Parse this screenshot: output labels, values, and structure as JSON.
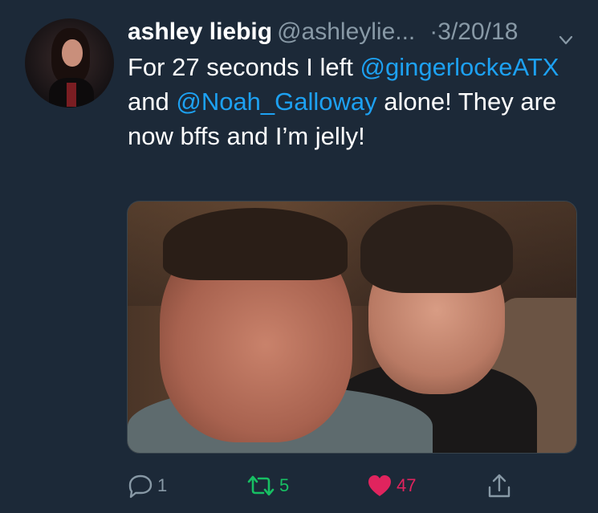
{
  "tweet": {
    "display_name": "ashley liebig",
    "handle": "@ashleylie...",
    "date": "3/20/18",
    "text": {
      "part1": "For 27 seconds I left ",
      "mention1": "@gingerlockeATX",
      "part2": " and ",
      "mention2": "@Noah_Galloway",
      "part3": " alone! They are now bffs and I’m jelly!"
    }
  },
  "actions": {
    "reply_count": "1",
    "retweet_count": "5",
    "like_count": "47"
  },
  "colors": {
    "background": "#1c2938",
    "mention": "#1da1f2",
    "secondary": "#8899a6",
    "retweet_active": "#17bf63",
    "like_active": "#e0245e"
  },
  "icons": [
    "avatar",
    "chevron-down-icon",
    "reply-icon",
    "retweet-icon",
    "heart-icon",
    "share-icon"
  ]
}
